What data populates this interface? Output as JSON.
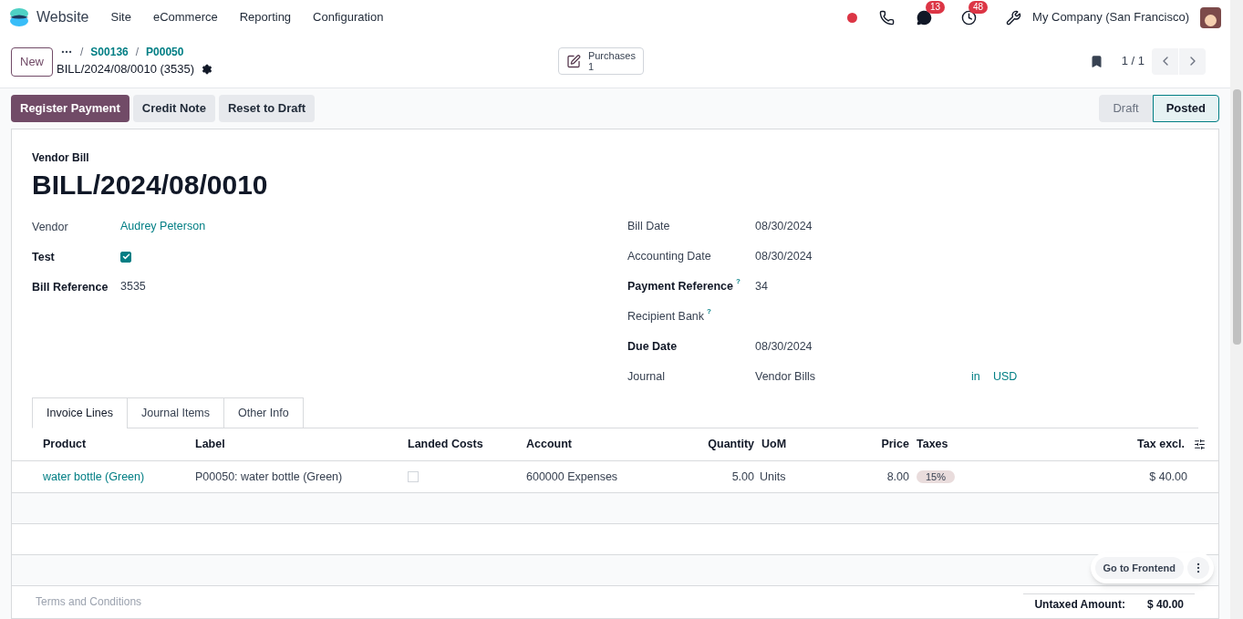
{
  "navbar": {
    "app": "Website",
    "menus": [
      "Site",
      "eCommerce",
      "Reporting",
      "Configuration"
    ],
    "messages_count": "13",
    "activities_count": "48",
    "company": "My Company (San Francisco)"
  },
  "control_panel": {
    "new_button": "New",
    "breadcrumb_separator": "/",
    "breadcrumbs": [
      "S00136",
      "P00050"
    ],
    "record_title": "BILL/2024/08/0010 (3535)",
    "smart_button": {
      "label": "Purchases",
      "count": "1"
    },
    "pager": "1 / 1"
  },
  "actions": [
    {
      "label": "Register Payment",
      "primary": true
    },
    {
      "label": "Credit Note",
      "primary": false
    },
    {
      "label": "Reset to Draft",
      "primary": false
    }
  ],
  "status_steps": [
    {
      "label": "Draft",
      "selected": false
    },
    {
      "label": "Posted",
      "selected": true
    }
  ],
  "sheet": {
    "type_label": "Vendor Bill",
    "name": "BILL/2024/08/0010",
    "left_fields": [
      {
        "label": "Vendor",
        "value": "Audrey Peterson",
        "kind": "link",
        "bold": false
      },
      {
        "label": "Test",
        "kind": "checkbox",
        "checked": true,
        "bold": true
      },
      {
        "label": "Bill Reference",
        "value": "3535",
        "kind": "text",
        "bold": true
      }
    ],
    "right_fields": [
      {
        "label": "Bill Date",
        "value": "08/30/2024",
        "bold": false
      },
      {
        "label": "Accounting Date",
        "value": "08/30/2024",
        "bold": false
      },
      {
        "label": "Payment Reference",
        "value": "34",
        "bold": true,
        "help": "?"
      },
      {
        "label": "Recipient Bank",
        "bold": false,
        "help": "?"
      },
      {
        "label": "Due Date",
        "value": "08/30/2024",
        "bold": true
      }
    ],
    "journal": {
      "label": "Journal",
      "value": "Vendor Bills",
      "in": "in",
      "currency": "USD"
    },
    "tabs": [
      {
        "label": "Invoice Lines",
        "selected": true
      },
      {
        "label": "Journal Items",
        "selected": false
      },
      {
        "label": "Other Info",
        "selected": false
      }
    ],
    "table": {
      "columns": [
        "Product",
        "Label",
        "Landed Costs",
        "Account",
        "Quantity",
        "UoM",
        "Price",
        "Taxes",
        "Tax excl."
      ],
      "rows": [
        {
          "product": "water bottle (Green)",
          "label": "P00050: water bottle (Green)",
          "landed_costs": false,
          "account": "600000 Expenses",
          "quantity": "5.00",
          "uom": "Units",
          "price": "8.00",
          "taxes": "15%",
          "tax_excl": "$ 40.00"
        }
      ]
    },
    "terms_placeholder": "Terms and Conditions",
    "untaxed_label": "Untaxed Amount:",
    "untaxed_value": "$ 40.00"
  },
  "floating": {
    "button": "Go to Frontend"
  }
}
